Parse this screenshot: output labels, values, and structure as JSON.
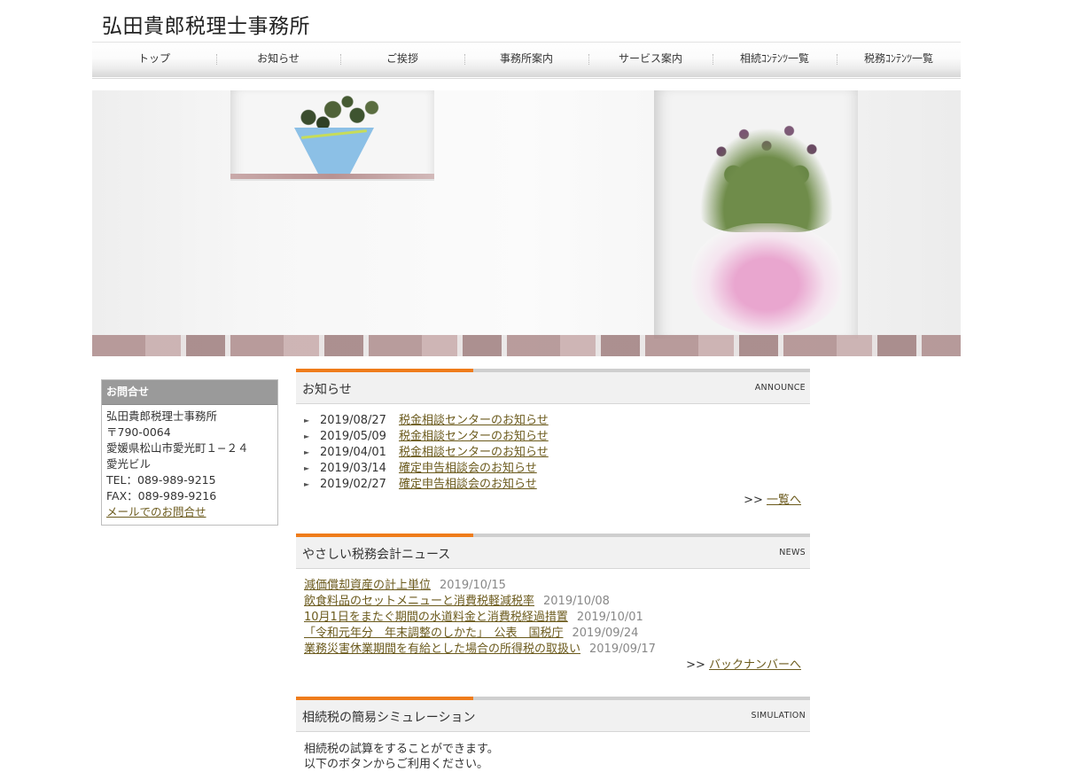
{
  "site": {
    "title": "弘田貴郎税理士事務所"
  },
  "gnav": [
    {
      "label": "トップ"
    },
    {
      "label": "お知らせ"
    },
    {
      "label": "ご挨拶"
    },
    {
      "label": "事務所案内"
    },
    {
      "label": "サービス案内"
    },
    {
      "label": "相続ｺﾝﾃﾝﾂ一覧"
    },
    {
      "label": "税務ｺﾝﾃﾝﾂ一覧"
    }
  ],
  "sidebar": {
    "heading": "お問合せ",
    "office": "弘田貴郎税理士事務所",
    "zip": "〒790-0064",
    "address1": "愛媛県松山市愛光町１−２４",
    "address2": "愛光ビル",
    "tel": "TEL：089-989-9215",
    "fax": "FAX：089-989-9216",
    "mail_link": "メールでのお問合せ"
  },
  "announce": {
    "title": "お知らせ",
    "en": "ANNOUNCE",
    "items": [
      {
        "date": "2019/08/27",
        "text": "税金相談センターのお知らせ"
      },
      {
        "date": "2019/05/09",
        "text": "税金相談センターのお知らせ"
      },
      {
        "date": "2019/04/01",
        "text": "税金相談センターのお知らせ"
      },
      {
        "date": "2019/03/14",
        "text": "確定申告相談会のお知らせ"
      },
      {
        "date": "2019/02/27",
        "text": "確定申告相談会のお知らせ"
      }
    ],
    "more_prefix": ">> ",
    "more_link": "一覧へ"
  },
  "news": {
    "title": "やさしい税務会計ニュース",
    "en": "NEWS",
    "items": [
      {
        "text": "減価償却資産の計上単位",
        "date": "2019/10/15"
      },
      {
        "text": "飲食料品のセットメニューと消費税軽減税率",
        "date": "2019/10/08"
      },
      {
        "text": "10月1日をまたぐ期間の水道料金と消費税経過措置",
        "date": "2019/10/01"
      },
      {
        "text": "「令和元年分　年末調整のしかた」　公表　国税庁",
        "date": "2019/09/24"
      },
      {
        "text": "業務災害休業期間を有給とした場合の所得税の取扱い",
        "date": "2019/09/17"
      }
    ],
    "more_prefix": ">> ",
    "more_link": "バックナンバーへ"
  },
  "simulation": {
    "title": "相続税の簡易シミュレーション",
    "en": "SIMULATION",
    "line1": "相続税の試算をすることができます。",
    "line2": "以下のボタンからご利用ください。"
  },
  "colors": {
    "accent": "#ef7c1b",
    "link": "#6b5a1c",
    "sidebar_head": "#9a9a9a"
  }
}
